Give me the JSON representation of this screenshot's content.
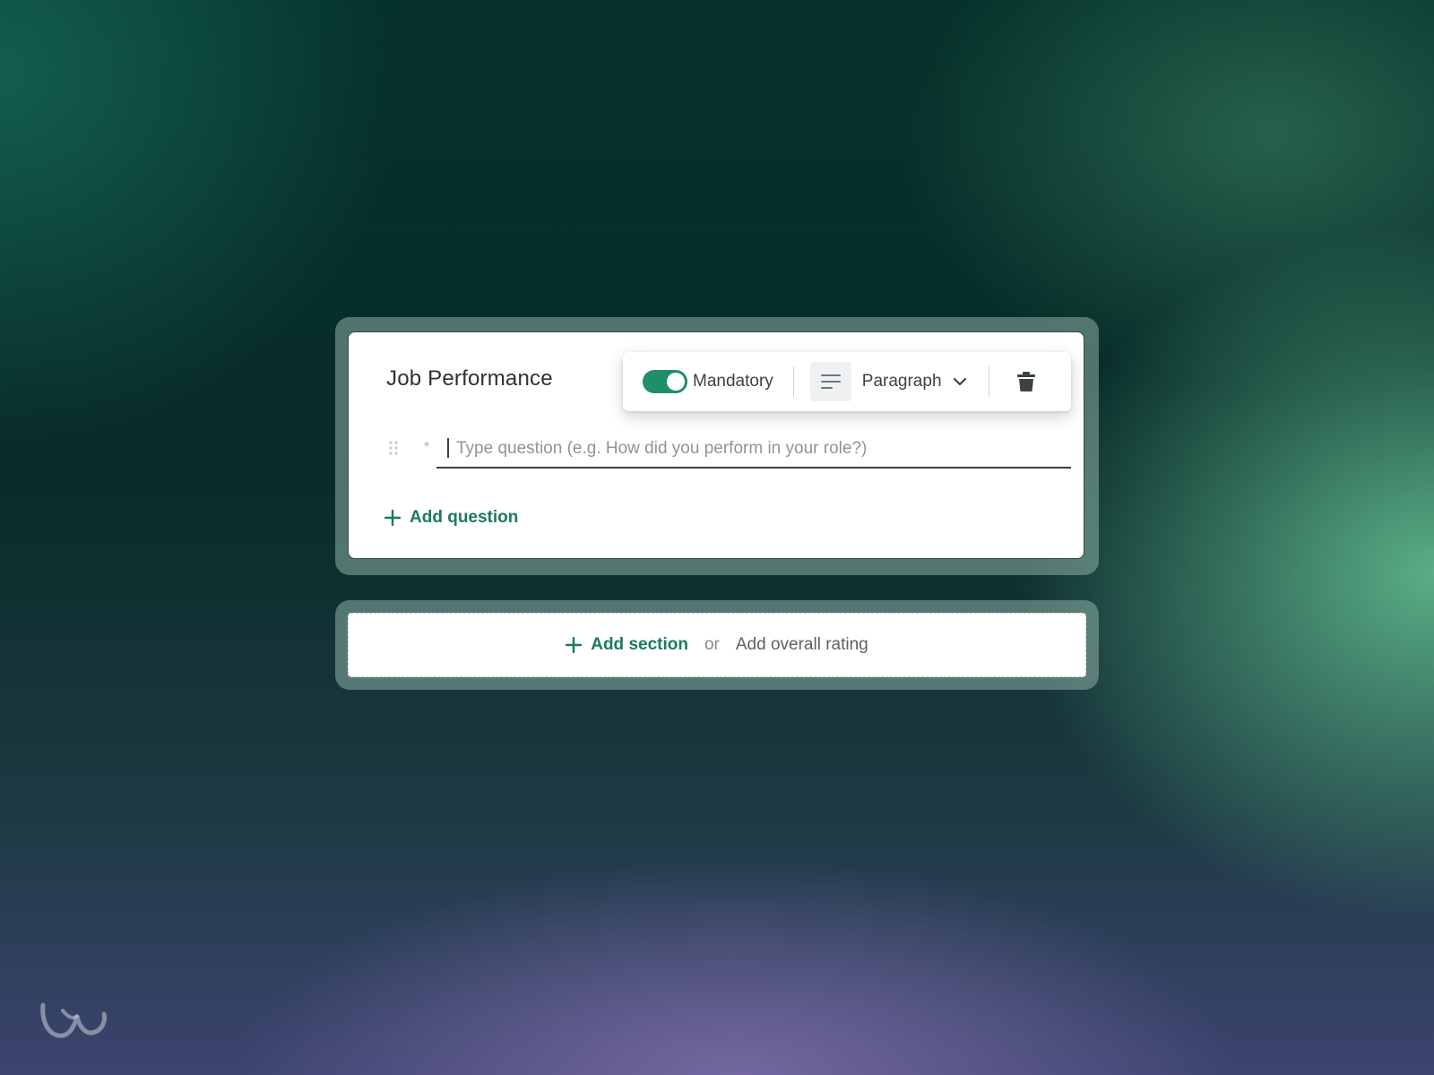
{
  "section": {
    "title": "Job Performance",
    "toolbar": {
      "mandatory_label": "Mandatory",
      "mandatory_on": true,
      "type_icon": "paragraph-lines-icon",
      "type_label": "Paragraph",
      "dropdown_icon": "chevron-down-icon",
      "delete_icon": "trash-icon"
    },
    "question": {
      "drag_icon": "drag-handle-icon",
      "required_marker": "*",
      "placeholder": "Type question (e.g. How did you perform in your role?)",
      "value": ""
    },
    "add_question_label": "Add question"
  },
  "add_bar": {
    "add_section_label": "Add section",
    "or_text": "or",
    "add_rating_label": "Add overall rating"
  },
  "colors": {
    "accent": "#1b7a5e",
    "toggle_on": "#1f8f68",
    "text": "#3b4246"
  }
}
